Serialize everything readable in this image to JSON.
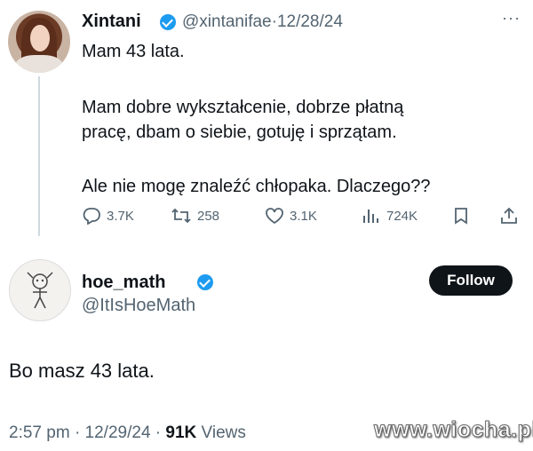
{
  "tweet": {
    "author_name": "Xintani",
    "author_handle": "@xintanifae",
    "separator": "·",
    "date": "12/28/24",
    "more_label": "···",
    "lines": [
      "Mam 43 lata.",
      "Mam dobre wykształcenie, dobrze płatną",
      "pracę, dbam o siebie, gotuję i sprzątam.",
      "Ale nie mogę znaleźć chłopaka. Dlaczego??"
    ],
    "actions": {
      "replies": "3.7K",
      "retweets": "258",
      "likes": "3.1K",
      "views": "724K"
    }
  },
  "reply": {
    "author_name": "hoe_math",
    "author_handle": "@ItIsHoeMath",
    "follow_label": "Follow",
    "text": "Bo masz 43 lata.",
    "time": "2:57 pm",
    "separator": "·",
    "date": "12/29/24",
    "views_count": "91K",
    "views_label": "Views"
  },
  "watermark": "www.wiocha.pl",
  "colors": {
    "text": "#0f1419",
    "secondary": "#536471",
    "verified": "#1d9bf0",
    "button": "#0f1419"
  },
  "icons": [
    "reply-icon",
    "retweet-icon",
    "like-icon",
    "views-icon",
    "bookmark-icon",
    "share-icon",
    "verified-badge-icon",
    "more-icon"
  ]
}
